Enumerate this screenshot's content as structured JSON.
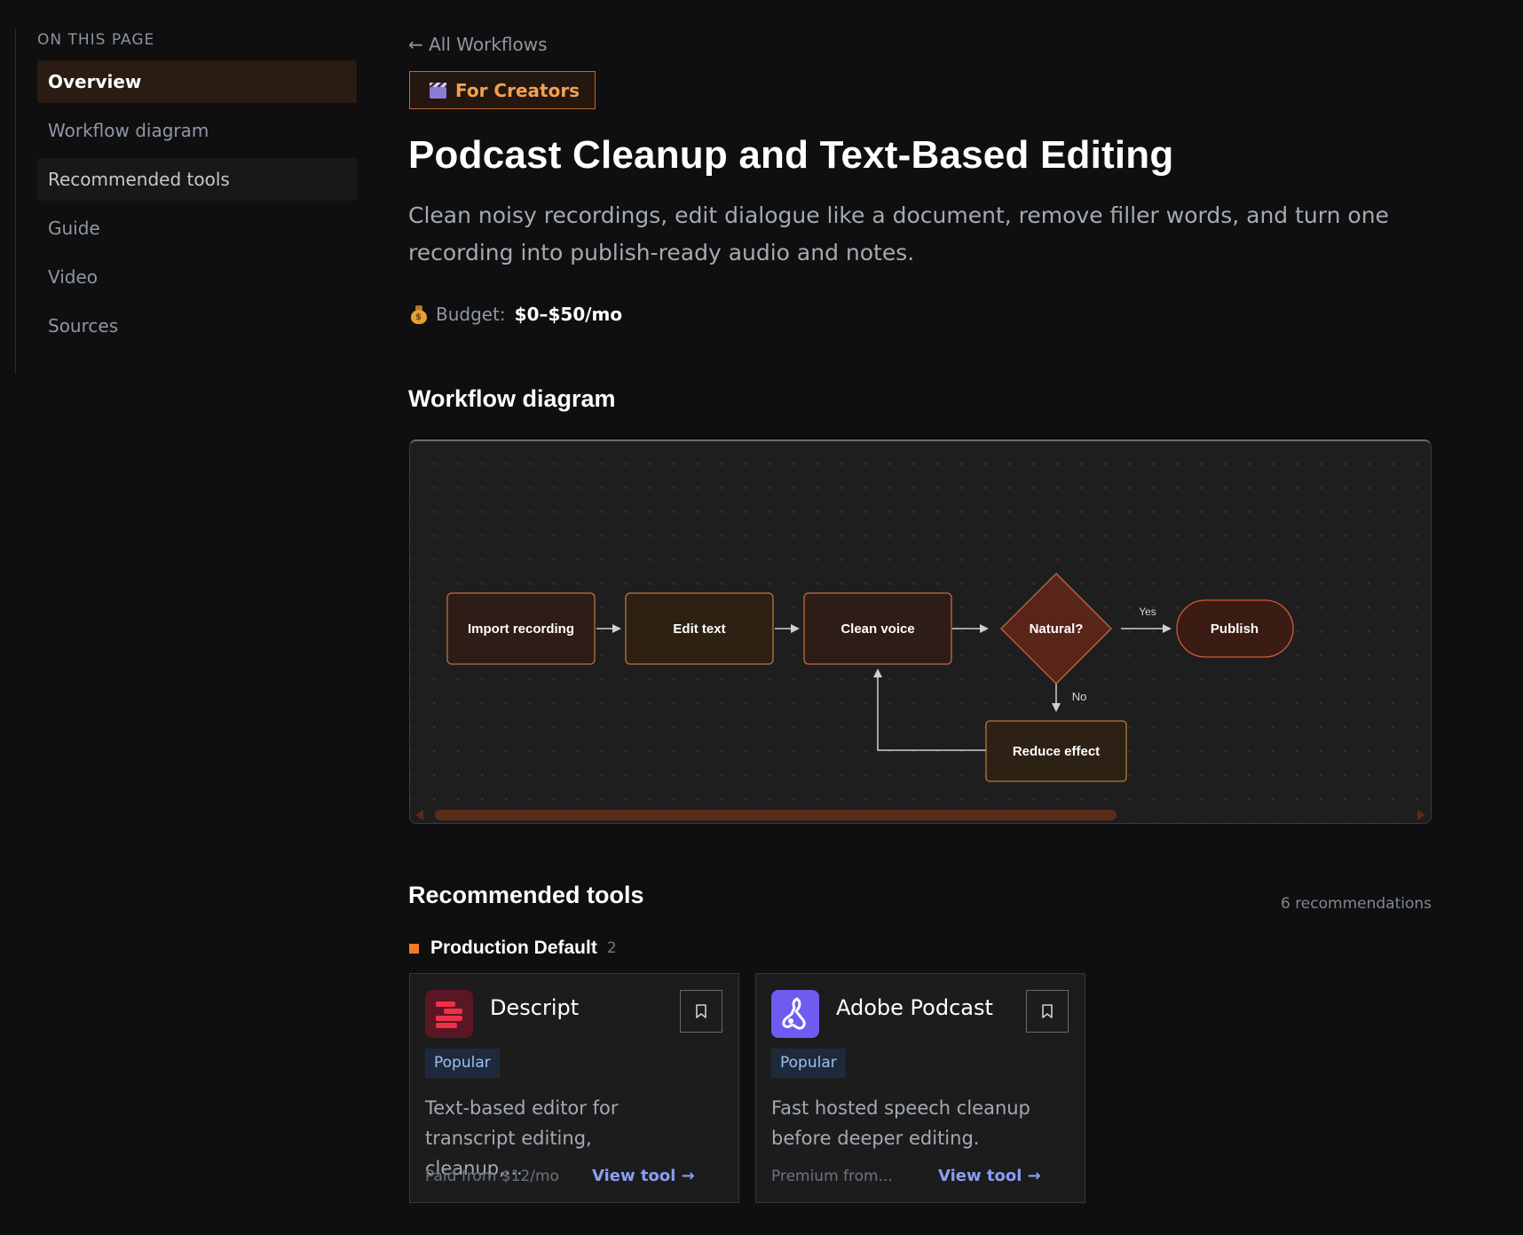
{
  "toc": {
    "heading": "ON THIS PAGE",
    "items": [
      {
        "label": "Overview"
      },
      {
        "label": "Workflow diagram"
      },
      {
        "label": "Recommended tools"
      },
      {
        "label": "Guide"
      },
      {
        "label": "Video"
      },
      {
        "label": "Sources"
      }
    ]
  },
  "header": {
    "back_link": "← All Workflows",
    "category": "For Creators",
    "category_icon": "clapperboard-icon",
    "title": "Podcast Cleanup and Text-Based Editing",
    "description": "Clean noisy recordings, edit dialogue like a document, remove filler words, and turn one recording into publish-ready audio and notes.",
    "budget_label": "Budget:",
    "budget_value": "$0–$50/mo",
    "budget_icon": "money-bag-icon"
  },
  "diagram": {
    "section_title": "Workflow diagram",
    "nodes": {
      "import": "Import recording",
      "edit": "Edit text",
      "clean": "Clean voice",
      "natural": "Natural?",
      "publish": "Publish",
      "reduce": "Reduce effect"
    },
    "edge_labels": {
      "yes": "Yes",
      "no": "No"
    }
  },
  "tools": {
    "section_title": "Recommended tools",
    "count_label": "6 recommendations",
    "group": {
      "title": "Production Default",
      "count": "2"
    },
    "cards": [
      {
        "name": "Descript",
        "tag": "Popular",
        "description": "Text-based editor for transcript editing, cleanup,...",
        "price": "Paid from $12/mo",
        "link": "View tool →",
        "logo_icon": "descript-logo-icon"
      },
      {
        "name": "Adobe Podcast",
        "tag": "Popular",
        "description": "Fast hosted speech cleanup before deeper editing.",
        "price": "Premium from...",
        "link": "View tool →",
        "logo_icon": "adobe-podcast-logo-icon"
      }
    ]
  },
  "colors": {
    "accent": "#f07a2a",
    "link": "#8b9cf3",
    "background": "#0f0f0f"
  }
}
